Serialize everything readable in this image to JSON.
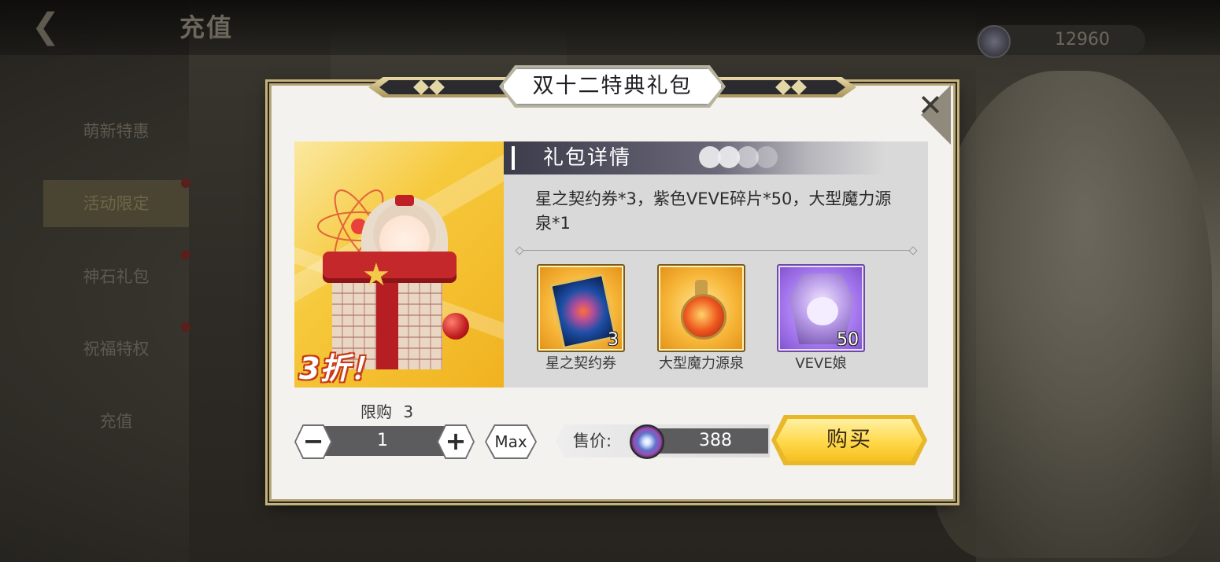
{
  "header": {
    "title": "充值",
    "currency_amount": "12960"
  },
  "sidebar": {
    "items": [
      {
        "label": "萌新特惠"
      },
      {
        "label": "活动限定"
      },
      {
        "label": "神石礼包"
      },
      {
        "label": "祝福特权"
      },
      {
        "label": "充值"
      }
    ],
    "active_index": 1
  },
  "modal": {
    "title": "双十二特典礼包",
    "discount_label": "3折！",
    "details_title": "礼包详情",
    "description": "星之契约券*3，紫色VEVE碎片*50，大型魔力源泉*1",
    "items": [
      {
        "name": "星之契约券",
        "count": "3",
        "icon": "star-contract-ticket-icon"
      },
      {
        "name": "大型魔力源泉",
        "count": "",
        "icon": "magic-fountain-bottle-icon"
      },
      {
        "name": "VEVE娘",
        "count": "50",
        "icon": "veve-fragment-icon"
      }
    ],
    "limit_label": "限购",
    "limit_value": "3",
    "quantity": "1",
    "minus_symbol": "−",
    "plus_symbol": "+",
    "max_label": "Max",
    "price_label": "售价:",
    "price_value": "388",
    "buy_label": "购买",
    "close_symbol": "✕"
  },
  "colors": {
    "accent_gold": "#ffd84a",
    "frame_gold": "#c5b27a",
    "dark_bar": "#5c5c5e"
  }
}
